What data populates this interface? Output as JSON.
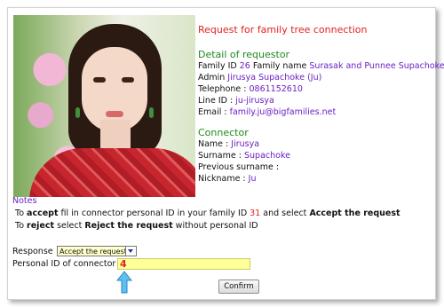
{
  "heading": "Request for family tree connection",
  "requestor": {
    "section_title": "Detail of requestor",
    "family_id_label": "Family ID ",
    "family_id": "26",
    "family_name_label": " Family name ",
    "family_name": "Surasak and Punnee Supachoke",
    "admin_label": "Admin ",
    "admin": "Jirusya Supachoke (Ju)",
    "telephone_label": "Telephone : ",
    "telephone": "0861152610",
    "line_label": "Line ID : ",
    "line_id": "ju-jirusya",
    "email_label": "Email : ",
    "email": "family.ju@bigfamilies.net"
  },
  "connector": {
    "section_title": "Connector",
    "name_label": "Name : ",
    "name": "Jirusya",
    "surname_label": "Surname : ",
    "surname": "Supachoke",
    "prev_surname_label": "Previous surname :",
    "nickname_label": "Nickname : ",
    "nickname": "Ju"
  },
  "notes": {
    "title": "Notes",
    "line1_a": "To ",
    "line1_b": "accept",
    "line1_c": " fil in connector personal ID in your family ID ",
    "line1_id": "31",
    "line1_d": " and select ",
    "line1_e": "Accept the request",
    "line2_a": "To ",
    "line2_b": "reject",
    "line2_c": "  select ",
    "line2_d": "Reject the request",
    "line2_e": " without personal ID"
  },
  "form": {
    "response_label": "Response",
    "response_value": "Accept the request",
    "personal_id_label": "Personal ID of connector",
    "personal_id_value": "4",
    "confirm_label": "Confirm"
  },
  "colors": {
    "heading": "#e32020",
    "section": "#1d8a1d",
    "value": "#6a1fc2",
    "input_bg": "#ffff99"
  }
}
